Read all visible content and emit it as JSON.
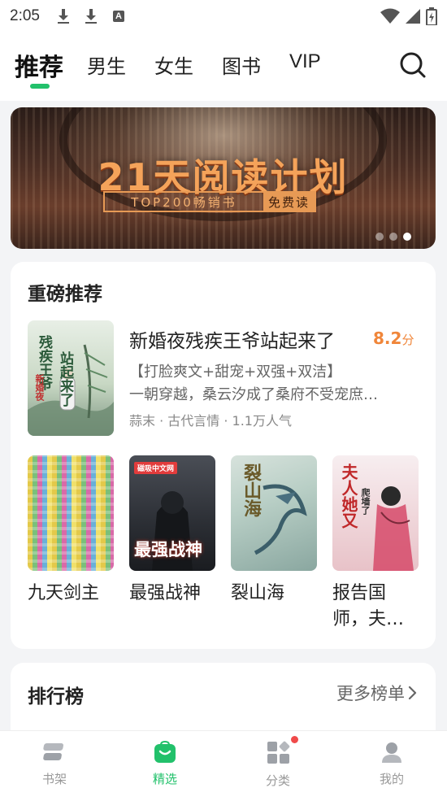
{
  "status_bar": {
    "time": "2:05"
  },
  "top_nav": {
    "tabs": [
      {
        "label": "推荐",
        "active": true
      },
      {
        "label": "男生"
      },
      {
        "label": "女生"
      },
      {
        "label": "图书"
      },
      {
        "label": "VIP"
      }
    ]
  },
  "banner": {
    "title": "21天阅读计划",
    "subtitle_left": "TOP200畅销书",
    "subtitle_right": "免费读",
    "slide_count": 3,
    "active_slide": 3
  },
  "featured": {
    "section_title": "重磅推荐",
    "book": {
      "title": "新婚夜残疾王爷站起来了",
      "score": "8.2",
      "score_unit": "分",
      "tags": "【打脸爽文+甜宠+双强+双洁】",
      "description": "一朝穿越，桑云汐成了桑府不受宠庶…",
      "meta": "蒜末 · 古代言情 · 1.1万人气",
      "cover_text_1": "残疾王爷",
      "cover_text_2": "站起来了",
      "cover_badge": "新婚夜"
    },
    "books": [
      {
        "title": "九天剑主"
      },
      {
        "title": "最强战神",
        "cover_text": "最强战神",
        "cover_badge": "磁吸中文网"
      },
      {
        "title": "裂山海",
        "cover_text": "裂山海"
      },
      {
        "title": "报告国师，夫…",
        "cover_text": "夫人她又",
        "cover_text_2": "爬墙了"
      }
    ]
  },
  "ranking": {
    "section_title": "排行榜",
    "more_label": "更多榜单"
  },
  "bottom_nav": {
    "items": [
      {
        "label": "书架",
        "icon": "bookshelf-icon"
      },
      {
        "label": "精选",
        "icon": "featured-icon",
        "active": true
      },
      {
        "label": "分类",
        "icon": "category-icon",
        "badge": true
      },
      {
        "label": "我的",
        "icon": "profile-icon"
      }
    ]
  },
  "colors": {
    "accent": "#22c16b",
    "score": "#f0863a",
    "badge": "#f04a4a"
  }
}
